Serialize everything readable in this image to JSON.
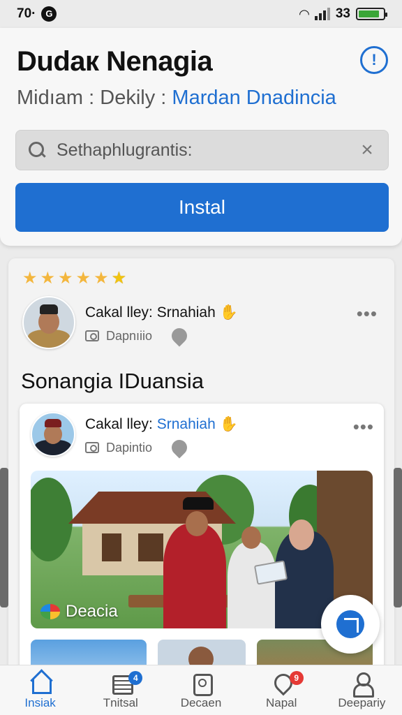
{
  "status": {
    "time": "70·",
    "status_glyph": "G",
    "signal_text": "33",
    "battery_level": 0.85
  },
  "header": {
    "title": "Dudaк Nenagia",
    "info_icon": "info-icon",
    "breadcrumb": {
      "part1": "Midıam",
      "sep1": ":",
      "part2": "Dekily",
      "sep2": ":",
      "link": "Mardan Dnadincia"
    },
    "search": {
      "placeholder": "Sethaphlugrantis:",
      "value": ""
    },
    "install_label": "Instal"
  },
  "feed": {
    "rating": 5,
    "post1": {
      "name": "Cakal lley:",
      "highlight": "Srnahiah",
      "sub": "Dapnıiio",
      "more": "•••"
    },
    "section_title": "Sonangia IDuansia",
    "post2": {
      "name": "Cakal lley:",
      "highlight": "Srnahiah",
      "sub": "Dapintio",
      "more": "•••"
    },
    "image_caption": "Deacia"
  },
  "tabs": [
    {
      "label": "Insiak",
      "icon": "home-icon",
      "active": true
    },
    {
      "label": "Tnitsal",
      "icon": "document-icon",
      "badge": "4",
      "badge_color": "#1f6fd1"
    },
    {
      "label": "Decaen",
      "icon": "frame-icon"
    },
    {
      "label": "Napal",
      "icon": "location-icon",
      "badge": "9",
      "badge_color": "#e53935"
    },
    {
      "label": "Deepariy",
      "icon": "user-icon"
    }
  ],
  "colors": {
    "accent": "#1f6fd1",
    "star": "#f3b63d",
    "battery": "#3aa637"
  }
}
